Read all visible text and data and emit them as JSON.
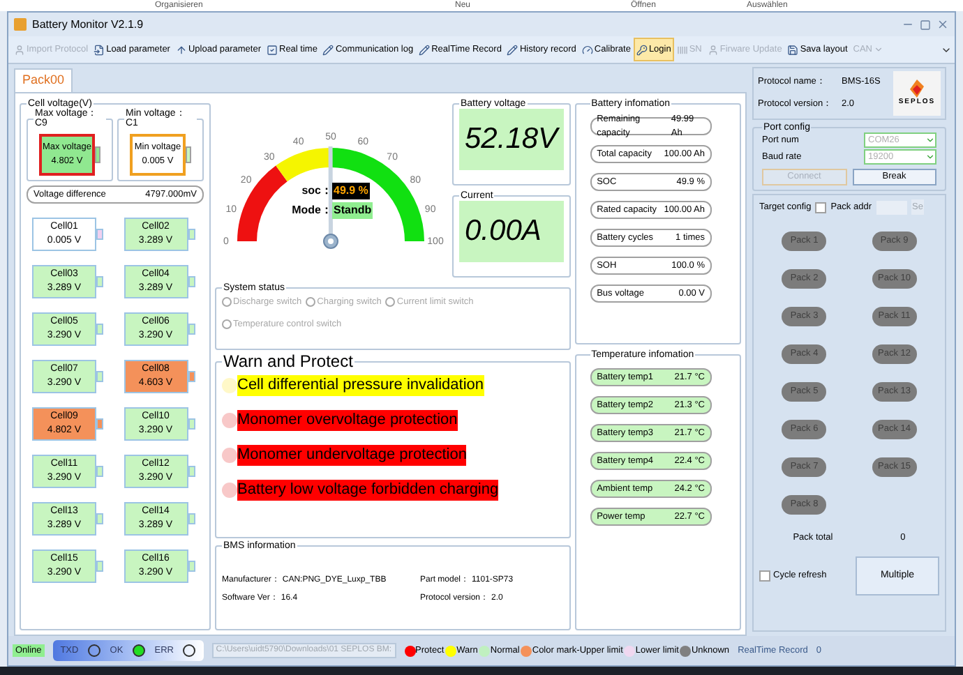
{
  "explorer_ribbon": [
    "Organisieren",
    "Neu",
    "Öffnen",
    "Auswählen"
  ],
  "window": {
    "title": "Battery Monitor V2.1.9"
  },
  "toolbar": [
    {
      "label": "Import Protocol",
      "disabled": true,
      "highlighted": false
    },
    {
      "label": "Load parameter",
      "disabled": false,
      "highlighted": false
    },
    {
      "label": "Upload parameter",
      "disabled": false,
      "highlighted": false
    },
    {
      "label": "Real time",
      "disabled": false,
      "highlighted": false
    },
    {
      "label": "Communication log",
      "disabled": false,
      "highlighted": false
    },
    {
      "label": "RealTime Record",
      "disabled": false,
      "highlighted": false
    },
    {
      "label": "History record",
      "disabled": false,
      "highlighted": false
    },
    {
      "label": "Calibrate",
      "disabled": false,
      "highlighted": false
    },
    {
      "label": "Login",
      "disabled": false,
      "highlighted": true
    },
    {
      "label": "SN",
      "disabled": true,
      "highlighted": false
    },
    {
      "label": "Firware Update",
      "disabled": true,
      "highlighted": false
    },
    {
      "label": "Sava layout",
      "disabled": false,
      "highlighted": false
    },
    {
      "label": "CAN",
      "disabled": true,
      "highlighted": false
    }
  ],
  "tabs": [
    {
      "label": "Pack00",
      "selected": true
    }
  ],
  "cell_voltage": {
    "title": "Cell voltage(V)",
    "max": {
      "title": "Max voltage：C9",
      "label": "Max voltage",
      "value": "4.802 V"
    },
    "min": {
      "title": "Min voltage：C1",
      "label": "Min voltage",
      "value": "0.005 V"
    },
    "difference": {
      "label": "Voltage difference",
      "value": "4797.000mV"
    },
    "cells": [
      {
        "name": "Cell01",
        "value": "0.005 V",
        "kind": "low"
      },
      {
        "name": "Cell02",
        "value": "3.289 V",
        "kind": "normal"
      },
      {
        "name": "Cell03",
        "value": "3.289 V",
        "kind": "normal"
      },
      {
        "name": "Cell04",
        "value": "3.289 V",
        "kind": "normal"
      },
      {
        "name": "Cell05",
        "value": "3.290 V",
        "kind": "normal"
      },
      {
        "name": "Cell06",
        "value": "3.290 V",
        "kind": "normal"
      },
      {
        "name": "Cell07",
        "value": "3.290 V",
        "kind": "normal"
      },
      {
        "name": "Cell08",
        "value": "4.603 V",
        "kind": "high"
      },
      {
        "name": "Cell09",
        "value": "4.802 V",
        "kind": "high"
      },
      {
        "name": "Cell10",
        "value": "3.290 V",
        "kind": "normal"
      },
      {
        "name": "Cell11",
        "value": "3.290 V",
        "kind": "normal"
      },
      {
        "name": "Cell12",
        "value": "3.290 V",
        "kind": "normal"
      },
      {
        "name": "Cell13",
        "value": "3.289 V",
        "kind": "normal"
      },
      {
        "name": "Cell14",
        "value": "3.289 V",
        "kind": "normal"
      },
      {
        "name": "Cell15",
        "value": "3.290 V",
        "kind": "normal"
      },
      {
        "name": "Cell16",
        "value": "3.290 V",
        "kind": "normal"
      }
    ]
  },
  "gauge": {
    "ticks": [
      "0",
      "10",
      "20",
      "30",
      "40",
      "50",
      "60",
      "70",
      "80",
      "90",
      "100"
    ],
    "level": 0.499,
    "soc_label": "soc：",
    "soc_value": "49.9 %",
    "mode_label": "Mode：",
    "mode_value": "Standb"
  },
  "battery_voltage": {
    "title": "Battery voltage",
    "value": "52.18V"
  },
  "current": {
    "title": "Current",
    "value": "0.00A"
  },
  "battery_information": {
    "title": "Battery infomation",
    "rows": [
      {
        "label": "Remaining capacity",
        "value": "49.99 Ah"
      },
      {
        "label": "Total capacity",
        "value": "100.00 Ah"
      },
      {
        "label": "SOC",
        "value": "49.9 %"
      },
      {
        "label": "Rated capacity",
        "value": "100.00 Ah"
      },
      {
        "label": "Battery cycles",
        "value": "1 times"
      },
      {
        "label": "SOH",
        "value": "100.0 %"
      },
      {
        "label": "Bus voltage",
        "value": "0.00 V"
      }
    ]
  },
  "system_status": {
    "title": "System status",
    "switches": [
      {
        "label": "Discharge switch",
        "checked": false
      },
      {
        "label": "Charging switch",
        "checked": false
      },
      {
        "label": "Current limit switch",
        "checked": false
      },
      {
        "label": "Temperature control switch",
        "checked": false
      }
    ]
  },
  "warn_and_protect": {
    "title": "Warn and Protect",
    "items": [
      {
        "text": "Cell differential pressure invalidation",
        "kind": "warn"
      },
      {
        "text": "Monomer overvoltage protection",
        "kind": "protect"
      },
      {
        "text": "Monomer undervoltage protection",
        "kind": "protect"
      },
      {
        "text": "Battery low voltage forbidden charging",
        "kind": "protect"
      }
    ]
  },
  "temperature_information": {
    "title": "Temperature infomation",
    "rows": [
      {
        "label": "Battery temp1",
        "value": "21.7 °C"
      },
      {
        "label": "Battery temp2",
        "value": "21.3 °C"
      },
      {
        "label": "Battery temp3",
        "value": "21.7 °C"
      },
      {
        "label": "Battery temp4",
        "value": "22.4 °C"
      },
      {
        "label": "Ambient temp",
        "value": "24.2 °C"
      },
      {
        "label": "Power temp",
        "value": "22.7 °C"
      }
    ]
  },
  "bms_information": {
    "title": "BMS information",
    "fields": [
      {
        "label": "Manufacturer：",
        "value": "CAN:PNG_DYE_Luxp_TBB"
      },
      {
        "label": "Part model：",
        "value": "1101-SP73"
      },
      {
        "label": "Software Ver：",
        "value": "16.4"
      },
      {
        "label": "Protocol version：",
        "value": "2.0"
      }
    ]
  },
  "protocol": {
    "name_label": "Protocol name：",
    "name": "BMS-16S",
    "version_label": "Protocol version：",
    "version": "2.0",
    "logo_text": "SEPLOS"
  },
  "port_config": {
    "title": "Port config",
    "port_label": "Port num",
    "port": "COM26",
    "baud_label": "Baud rate",
    "baud": "19200",
    "connect": {
      "label": "Connect",
      "disabled": true
    },
    "break": {
      "label": "Break",
      "disabled": false
    }
  },
  "target_config": {
    "title": "Target config",
    "pack_addr": {
      "label": "Pack addr",
      "checked": false
    },
    "set_button": "Se",
    "packs": [
      "Pack 1",
      "Pack 2",
      "Pack 3",
      "Pack 4",
      "Pack 5",
      "Pack 6",
      "Pack 7",
      "Pack 8",
      "Pack 9",
      "Pack 10",
      "Pack 11",
      "Pack 12",
      "Pack 13",
      "Pack 14",
      "Pack 15"
    ],
    "pack_total_label": "Pack total",
    "pack_total": "0",
    "cycle_refresh": {
      "label": "Cycle refresh",
      "checked": false
    },
    "multiple": "Multiple"
  },
  "status_bar": {
    "connection": "Online",
    "indicators": [
      {
        "label": "TXD",
        "on": false
      },
      {
        "label": "OK",
        "on": true
      },
      {
        "label": "ERR",
        "on": false
      }
    ],
    "path": "C:\\Users\\uidt5790\\Downloads\\01 SEPLOS BM:",
    "legend": [
      {
        "label": "Protect",
        "color": "#ff0000"
      },
      {
        "label": "Warn",
        "color": "#ffff00"
      },
      {
        "label": "Normal",
        "color": "#c0f0c0"
      },
      {
        "label": "Color mark-Upper limit",
        "color": "#f4915a"
      },
      {
        "label": "Lower limit",
        "color": "#f0d8f0"
      },
      {
        "label": "Unknown",
        "color": "#808080"
      }
    ],
    "record_label": "RealTime Record",
    "record_count": "0"
  }
}
